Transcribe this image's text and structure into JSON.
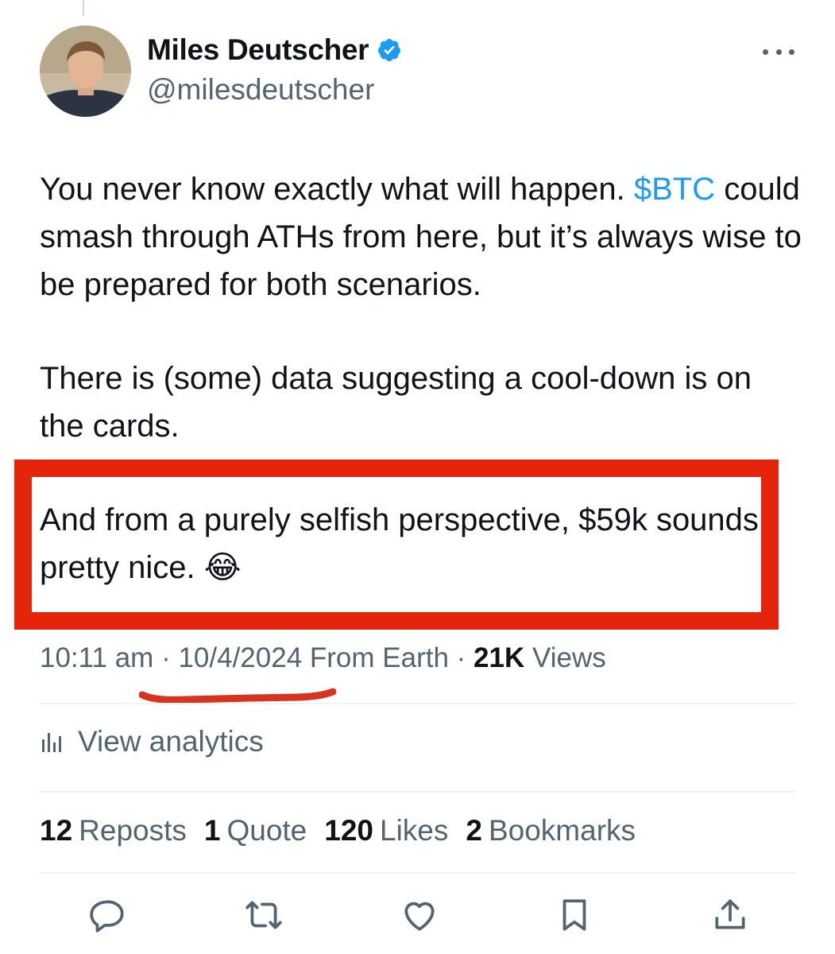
{
  "author": {
    "name": "Miles Deutscher",
    "handle": "@milesdeutscher",
    "verified": true
  },
  "tweet": {
    "line1_text": "You never know exactly what will happen. ",
    "cashtag": "$BTC",
    "line1_rest": "could smash through ATHs from here, but it’s always wise to be prepared for both scenarios.",
    "paragraph2": "There is (some) data suggesting a cool-down is on the cards.",
    "paragraph3": "And from a purely selfish perspective, $59k sounds pretty nice. 😂"
  },
  "meta": {
    "time": "10:11 am",
    "sep1": " · ",
    "date": "10/4/2024",
    "location": " From Earth",
    "sep2": " · ",
    "views_count": "21K",
    "views_label": " Views"
  },
  "analytics": {
    "label": "View analytics",
    "icon": "analytics-icon"
  },
  "stats": {
    "reposts_count": "12",
    "reposts_label": "Reposts",
    "quotes_count": "1",
    "quotes_label": "Quote",
    "likes_count": "120",
    "likes_label": "Likes",
    "bookmarks_count": "2",
    "bookmarks_label": "Bookmarks"
  },
  "actions": [
    {
      "icon": "reply-icon"
    },
    {
      "icon": "repost-icon"
    },
    {
      "icon": "like-icon"
    },
    {
      "icon": "bookmark-icon"
    },
    {
      "icon": "share-icon"
    }
  ],
  "colors": {
    "accent": "#1d9bf0",
    "annotation_red": "#e4250c",
    "secondary_text": "#536471",
    "primary_text": "#0f1419"
  }
}
